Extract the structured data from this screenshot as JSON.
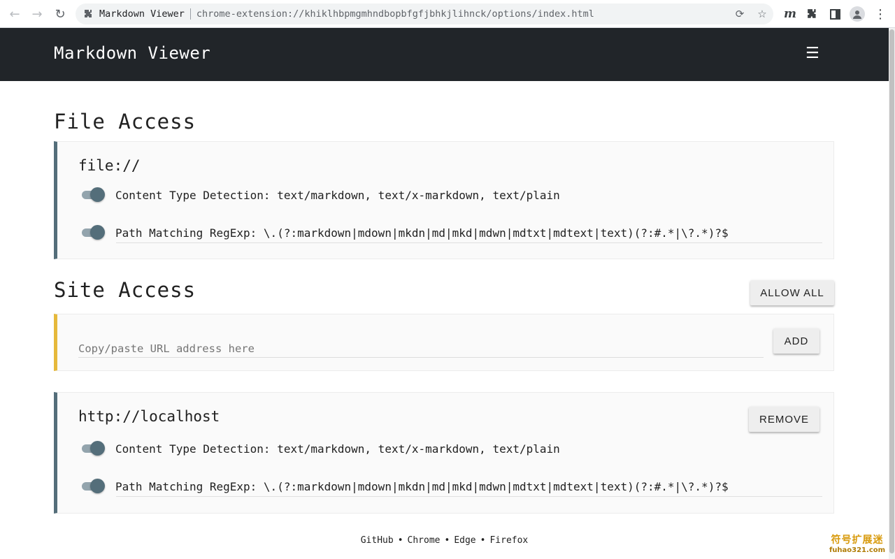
{
  "browser": {
    "extension_name": "Markdown Viewer",
    "url": "chrome-extension://khiklhbpmgmhndbopbfgfjbhkjlihnck/options/index.html",
    "icons": [
      "back-icon",
      "forward-icon",
      "reload-icon",
      "puzzle-icon",
      "share-icon",
      "star-icon",
      "markdown-extension-icon",
      "extensions-icon",
      "side-panel-icon",
      "profile-icon",
      "more-icon"
    ]
  },
  "header": {
    "title": "Markdown Viewer",
    "menu_icon": "hamburger-icon"
  },
  "file_access": {
    "title": "File Access",
    "origin": "file://",
    "content_type": "Content Type Detection: text/markdown, text/x-markdown, text/plain",
    "path_matching": "Path Matching RegExp: \\.(?:markdown|mdown|mkdn|md|mkd|mdwn|mdtxt|mdtext|text)(?:#.*|\\?.*)?$",
    "content_type_enabled": true,
    "path_matching_enabled": true
  },
  "site_access": {
    "title": "Site Access",
    "allow_all_label": "ALLOW ALL",
    "add_label": "ADD",
    "input_placeholder": "Copy/paste URL address here",
    "input_value": ""
  },
  "origins": [
    {
      "origin": "http://localhost",
      "remove_label": "REMOVE",
      "content_type": "Content Type Detection: text/markdown, text/x-markdown, text/plain",
      "path_matching": "Path Matching RegExp: \\.(?:markdown|mdown|mkdn|md|mkd|mdwn|mdtxt|mdtext|text)(?:#.*|\\?.*)?$",
      "content_type_enabled": true,
      "path_matching_enabled": true
    }
  ],
  "footer": {
    "links": [
      "GitHub",
      "Chrome",
      "Edge",
      "Firefox"
    ],
    "separator": "•"
  },
  "watermark": {
    "top": "符号扩展迷",
    "bottom": "fuhao321.com"
  },
  "colors": {
    "header_bg": "#212529",
    "card_accent": "#546e7a",
    "input_card_accent": "#e6b93b"
  }
}
